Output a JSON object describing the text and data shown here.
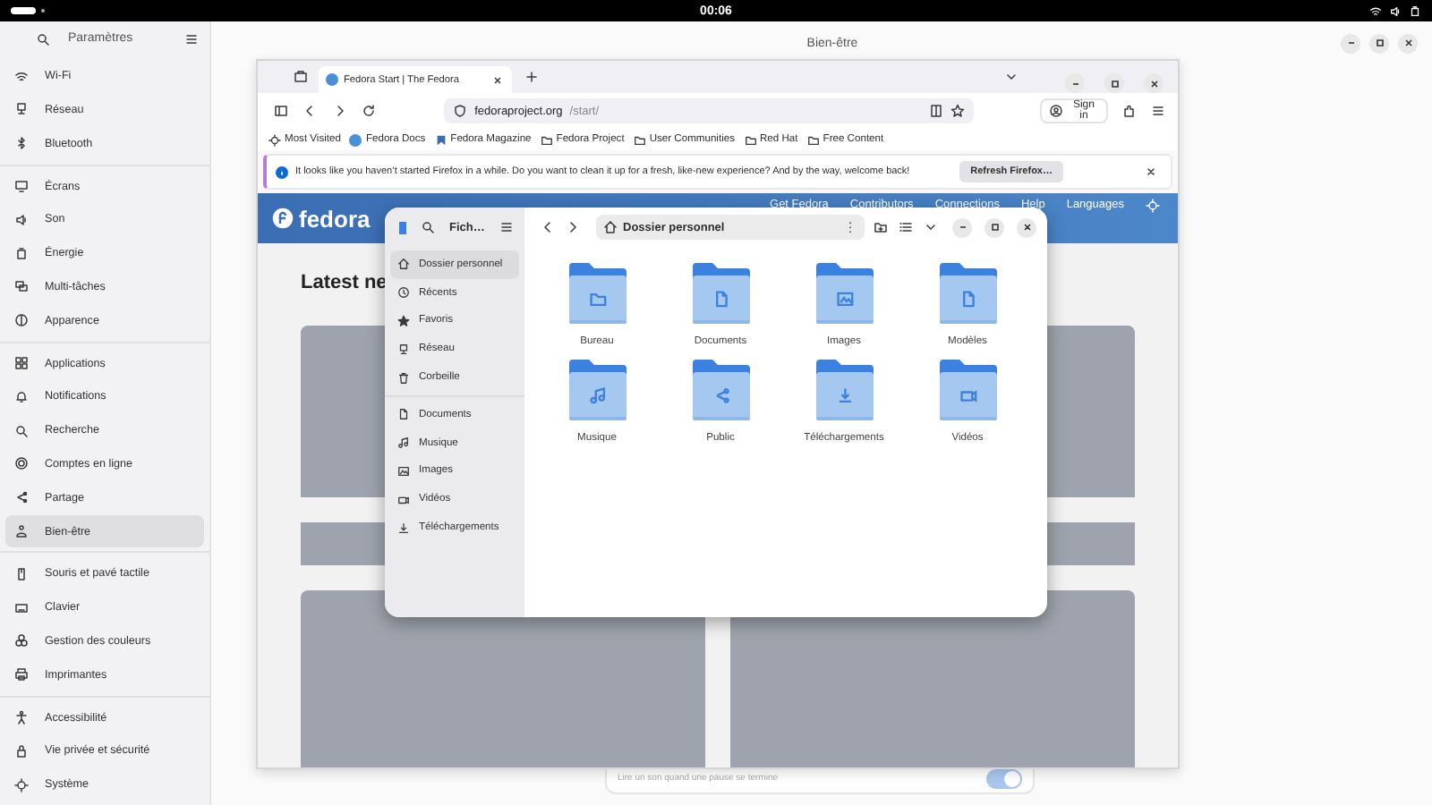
{
  "top_bar": {
    "clock": "00:06"
  },
  "settings": {
    "title": "Paramètres",
    "page_title": "Bien-être",
    "sidebar": {
      "groups": [
        [
          {
            "label": "Wi-Fi",
            "selected": false
          },
          {
            "label": "Réseau",
            "selected": false
          },
          {
            "label": "Bluetooth",
            "selected": false
          }
        ],
        [
          {
            "label": "Écrans",
            "selected": false
          },
          {
            "label": "Son",
            "selected": false
          },
          {
            "label": "Énergie",
            "selected": false
          },
          {
            "label": "Multi-tâches",
            "selected": false
          },
          {
            "label": "Apparence",
            "selected": false
          }
        ],
        [
          {
            "label": "Applications",
            "selected": false
          },
          {
            "label": "Notifications",
            "selected": false
          },
          {
            "label": "Recherche",
            "selected": false
          },
          {
            "label": "Comptes en ligne",
            "selected": false
          },
          {
            "label": "Partage",
            "selected": false
          },
          {
            "label": "Bien-être",
            "selected": true
          }
        ],
        [
          {
            "label": "Souris et pavé tactile",
            "selected": false
          },
          {
            "label": "Clavier",
            "selected": false
          },
          {
            "label": "Gestion des couleurs",
            "selected": false
          },
          {
            "label": "Imprimantes",
            "selected": false
          }
        ],
        [
          {
            "label": "Accessibilité",
            "selected": false
          },
          {
            "label": "Vie privée et sécurité",
            "selected": false
          },
          {
            "label": "Système",
            "selected": false
          }
        ]
      ]
    },
    "visible_row": {
      "description": "Lire un son quand une pause se termine",
      "on": true
    }
  },
  "firefox": {
    "tab": {
      "title": "Fedora Start | The Fedora",
      "selected": true
    },
    "url": {
      "host": "fedoraproject.org",
      "path": "/start/"
    },
    "sign_in": "Sign in",
    "bookmarks": [
      {
        "label": "Most Visited",
        "kind": "menu"
      },
      {
        "label": "Fedora Docs",
        "kind": "site"
      },
      {
        "label": "Fedora Magazine",
        "kind": "magazine"
      },
      {
        "label": "Fedora Project",
        "kind": "folder"
      },
      {
        "label": "User Communities",
        "kind": "folder"
      },
      {
        "label": "Red Hat",
        "kind": "folder"
      },
      {
        "label": "Free Content",
        "kind": "folder"
      }
    ],
    "notification": {
      "message": "It looks like you haven’t started Firefox in a while. Do you want to clean it up for a fresh, like-new experience? And by the way, welcome back!",
      "button": "Refresh Firefox…"
    },
    "site": {
      "logo": "fedora",
      "nav": [
        "Get Fedora",
        "Contributors",
        "Connections",
        "Help",
        "Languages"
      ],
      "heading": "Latest ne"
    }
  },
  "files": {
    "title": "Fich…",
    "path": "Dossier personnel",
    "sidebar": {
      "groups": [
        [
          {
            "label": "Dossier personnel",
            "selected": true
          },
          {
            "label": "Récents",
            "selected": false
          },
          {
            "label": "Favoris",
            "selected": false
          },
          {
            "label": "Réseau",
            "selected": false
          },
          {
            "label": "Corbeille",
            "selected": false
          }
        ],
        [
          {
            "label": "Documents",
            "selected": false
          },
          {
            "label": "Musique",
            "selected": false
          },
          {
            "label": "Images",
            "selected": false
          },
          {
            "label": "Vidéos",
            "selected": false
          },
          {
            "label": "Téléchargements",
            "selected": false
          }
        ]
      ]
    },
    "folders": [
      {
        "name": "Bureau"
      },
      {
        "name": "Documents"
      },
      {
        "name": "Images"
      },
      {
        "name": "Modèles"
      },
      {
        "name": "Musique"
      },
      {
        "name": "Public"
      },
      {
        "name": "Téléchargements"
      },
      {
        "name": "Vidéos"
      }
    ]
  }
}
